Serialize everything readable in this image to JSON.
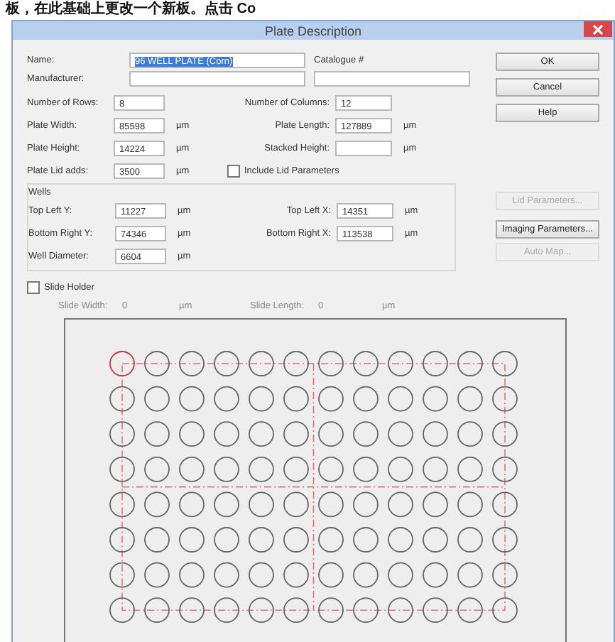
{
  "header_text": "板，在此基础上更改一个新板。点击 Co",
  "window": {
    "title": "Plate Description"
  },
  "name": {
    "label": "Name:",
    "value": "96 WELL PLATE (Corn)"
  },
  "catalogue": {
    "label": "Catalogue #"
  },
  "manufacturer": {
    "label": "Manufacturer:"
  },
  "plate_rows": [
    {
      "left": {
        "label": "Number of Rows:",
        "value": "8"
      },
      "right": {
        "label": "Number of Columns:",
        "value": "12"
      }
    },
    {
      "left": {
        "label": "Plate Width:",
        "value": "85598",
        "unit": "µm"
      },
      "right": {
        "label": "Plate Length:",
        "value": "127889",
        "unit": "µm"
      }
    },
    {
      "left": {
        "label": "Plate Height:",
        "value": "14224",
        "unit": "µm"
      },
      "right": {
        "label": "Stacked Height:",
        "unit": "µm"
      }
    },
    {
      "left": {
        "label": "Plate Lid adds:",
        "value": "3500",
        "unit": "µm"
      },
      "checkbox": {
        "label": "Include Lid Parameters",
        "checked": false
      }
    }
  ],
  "wells": {
    "label": "Wells",
    "rows": [
      {
        "left": {
          "label": "Top Left Y:",
          "value": "11227",
          "unit": "µm"
        },
        "right": {
          "label": "Top Left X:",
          "value": "14351",
          "unit": "µm"
        }
      },
      {
        "left": {
          "label": "Bottom Right Y:",
          "value": "74346",
          "unit": "µm"
        },
        "right": {
          "label": "Bottom Right X:",
          "value": "113538",
          "unit": "µm"
        }
      },
      {
        "left": {
          "label": "Well Diameter:",
          "value": "6604",
          "unit": "µm"
        }
      }
    ]
  },
  "slide_holder": {
    "label": "Slide Holder",
    "checked": false,
    "width": {
      "label": "Slide Width:",
      "value": "0",
      "unit": "µm"
    },
    "length": {
      "label": "Slide Length:",
      "value": "0",
      "unit": "µm"
    }
  },
  "button_groups": [
    [
      {
        "label": "OK",
        "disabled": false
      },
      {
        "label": "Cancel",
        "disabled": false
      },
      {
        "label": "Help",
        "disabled": false
      }
    ],
    [
      {
        "label": "Lid Parameters...",
        "disabled": true
      }
    ],
    [
      {
        "label": "Imaging Parameters...",
        "disabled": false
      },
      {
        "label": "Auto Map...",
        "disabled": true
      }
    ]
  ]
}
